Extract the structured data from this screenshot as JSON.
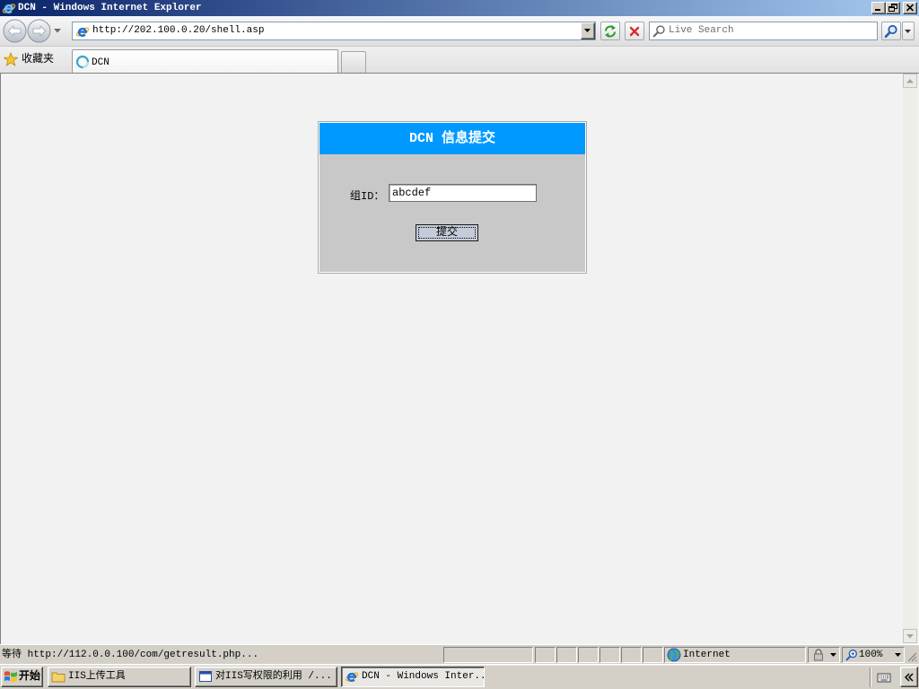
{
  "window": {
    "title": "DCN - Windows Internet Explorer"
  },
  "navigation": {
    "url": "http://202.100.0.20/shell.asp"
  },
  "search": {
    "placeholder": "Live Search"
  },
  "favorites": {
    "label": "收藏夹"
  },
  "tabs": [
    {
      "label": "DCN",
      "active": true
    }
  ],
  "form": {
    "title": "DCN 信息提交",
    "group_id_label": "组ID：",
    "group_id_value": "abcdef",
    "submit_label": "提交"
  },
  "status_bar": {
    "message": "等待 http://112.0.0.100/com/getresult.php...",
    "zone": "Internet",
    "zoom": "100%"
  },
  "taskbar": {
    "start_label": "开始",
    "tasks": [
      {
        "label": "IIS上传工具",
        "icon": "folder-icon",
        "active": false
      },
      {
        "label": "对IIS写权限的利用 /...",
        "icon": "window-icon",
        "active": false
      },
      {
        "label": "DCN - Windows Inter...",
        "icon": "internet-explorer-icon",
        "active": true
      }
    ]
  },
  "colors": {
    "titlebar_start": "#0a246a",
    "titlebar_end": "#a6caf0",
    "form_header": "#0099ff",
    "form_body": "#c8c8c8",
    "page_background": "#f2f2f2"
  }
}
